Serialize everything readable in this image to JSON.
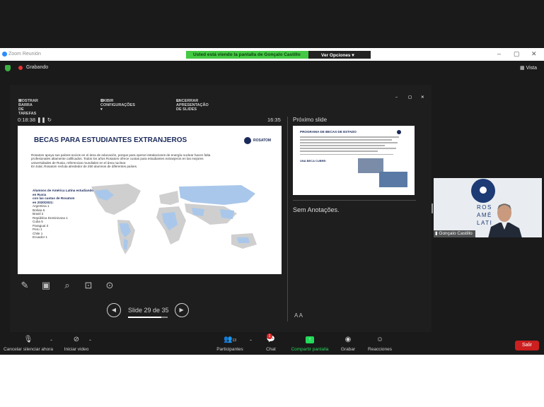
{
  "titlebar": {
    "app_title": "Zoom Reunión",
    "controls": [
      "–",
      "▢",
      "✕"
    ]
  },
  "share_banner": {
    "message": "Usted está viendo la pantalla de Gonçalo Castillo",
    "view_options": "Ver Opciones ▾"
  },
  "top": {
    "recording": "Grabando",
    "view": "Vista"
  },
  "presenter_toolbar": {
    "taskbar": "MOSTRAR BARRA DE TAREFAS",
    "settings": "EXIBIR CONFIGURAÇÕES ▾",
    "end": "ENCERRAR APRESENTAÇÃO DE SLIDES",
    "win_controls": [
      "–",
      "▢",
      "✕"
    ]
  },
  "presenter": {
    "elapsed": "0:18:38",
    "clock": "16:35",
    "next_label": "Próximo slide",
    "notes": "Sem Anotações.",
    "slide_counter": "Slide 29 de 35",
    "font_controls": "A  A"
  },
  "slide": {
    "title": "BECAS PARA ESTUDIANTES EXTRANJEROS",
    "logo": "ROSATOM",
    "body": [
      "Rosatom apoya sus países-socios en el área de educación, porque para operar instalaciones de energía nuclear hacen falta",
      "profesionales altamente calificados. Todos los años Rosatom ofrece cuotas para estudiantes extranjeros en las mejores",
      "universidades de Rusia, referencias mundiales en el área nuclear.",
      "En total, Rosatom recluta alrededor de 250 alumnos de diferentes países."
    ],
    "list_heading": [
      "Alumnos de América Latina estudiando",
      "en Rusia",
      "con las cuotas de Rosatom",
      "en 2020/2021:"
    ],
    "list": [
      "Argentina 1",
      "Bolivia 5",
      "Brasil 2",
      "República Dominicana 1",
      "Cuba 5",
      "Paraguai 3",
      "Peru 1",
      "Chile 1",
      "Ecuador 1"
    ]
  },
  "next_slide": {
    "title": "PROGRAMA DE BECAS DE ESTADO",
    "subtitle": "UNA BECA CUBRE:"
  },
  "video": {
    "name": "Gonçalo Castillo",
    "wall_text": [
      "ROS",
      "AMÉ",
      "LATI"
    ]
  },
  "controls": {
    "mute": "Cancelar silenciar ahora",
    "video": "Iniciar video",
    "participants": "Participantes",
    "participants_count": "13",
    "chat": "Chat",
    "chat_badge": "1",
    "share": "Compartir pantalla",
    "record": "Grabar",
    "reactions": "Reacciones",
    "leave": "Salir"
  },
  "colors": {
    "accent_green": "#23d959",
    "leave_red": "#cc1f1f",
    "banner_green": "#44c944"
  },
  "icons": [
    "shield-icon",
    "record-dot-icon",
    "grid-icon",
    "settings-icon",
    "screen-icon",
    "pen-icon",
    "layout-icon",
    "search-icon",
    "pointer-icon",
    "more-icon",
    "prev-icon",
    "next-icon",
    "mic-muted-icon",
    "video-off-icon",
    "participants-icon",
    "chat-icon",
    "share-icon",
    "record-icon",
    "reactions-icon"
  ]
}
